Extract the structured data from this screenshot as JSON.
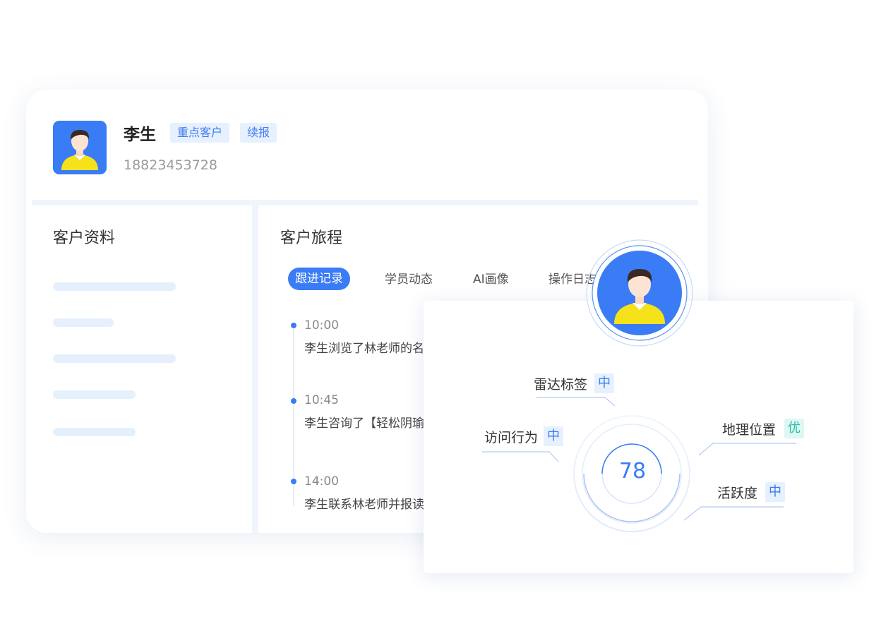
{
  "customer": {
    "name": "李生",
    "tags": [
      "重点客户",
      "续报"
    ],
    "phone": "18823453728"
  },
  "profile_section": {
    "title": "客户资料"
  },
  "journey_section": {
    "title": "客户旅程",
    "tabs": [
      "跟进记录",
      "学员动态",
      "AI画像",
      "操作日志"
    ],
    "active_tab": "跟进记录",
    "timeline": [
      {
        "time": "10:00",
        "text": "李生浏览了林老师的名"
      },
      {
        "time": "10:45",
        "text": "李生咨询了【轻松阴瑜"
      },
      {
        "time": "14:00",
        "text": "李生联系林老师并报读"
      }
    ]
  },
  "radar": {
    "score": "78",
    "items": [
      {
        "label": "雷达标签",
        "level": "中"
      },
      {
        "label": "访问行为",
        "level": "中"
      },
      {
        "label": "地理位置",
        "level": "优"
      },
      {
        "label": "活跃度",
        "level": "中"
      }
    ]
  },
  "colors": {
    "accent": "#3a7cf5",
    "tag_bg": "#e7f0ff",
    "excellent": "#29bfa5",
    "placeholder": "#e6effc"
  }
}
